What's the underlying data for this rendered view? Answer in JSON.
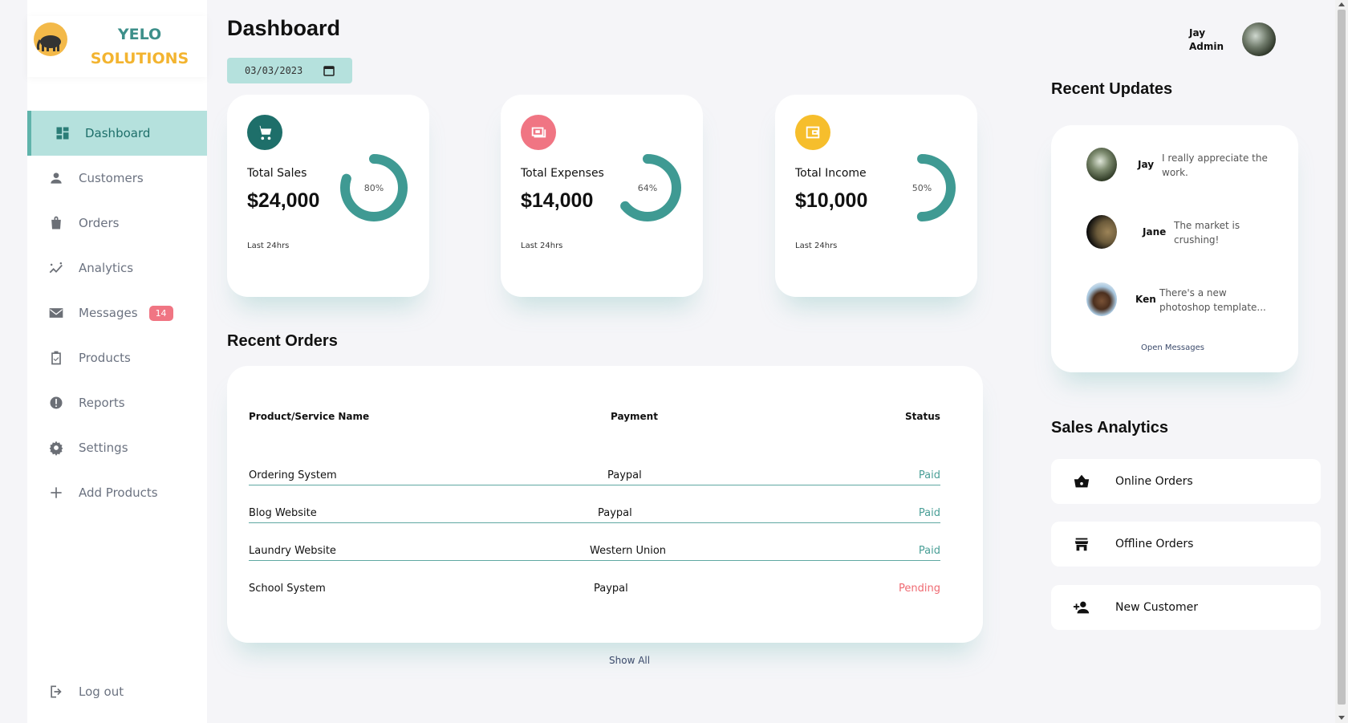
{
  "logo": {
    "line1": "YELO",
    "line2": "SOLUTIONS"
  },
  "sidebar": {
    "items": [
      {
        "label": "Dashboard",
        "icon": "dashboard-icon"
      },
      {
        "label": "Customers",
        "icon": "person-icon"
      },
      {
        "label": "Orders",
        "icon": "bag-icon"
      },
      {
        "label": "Analytics",
        "icon": "analytics-icon"
      },
      {
        "label": "Messages",
        "icon": "mail-icon",
        "badge": "14"
      },
      {
        "label": "Products",
        "icon": "clipboard-check-icon"
      },
      {
        "label": "Reports",
        "icon": "report-icon"
      },
      {
        "label": "Settings",
        "icon": "gear-icon"
      },
      {
        "label": "Add Products",
        "icon": "plus-icon"
      }
    ],
    "logout": "Log out"
  },
  "header": {
    "title": "Dashboard",
    "date": "03/03/2023"
  },
  "profile": {
    "name": "Jay",
    "role": "Admin"
  },
  "insights": [
    {
      "label": "Total Sales",
      "value": "$24,000",
      "percent": "80%",
      "sub": "Last 24hrs",
      "color": "#1e6f6a",
      "icon": "cart-icon",
      "fraction": 0.8
    },
    {
      "label": "Total Expenses",
      "value": "$14,000",
      "percent": "64%",
      "sub": "Last 24hrs",
      "color": "#f07583",
      "icon": "money-icon",
      "fraction": 0.64
    },
    {
      "label": "Total Income",
      "value": "$10,000",
      "percent": "50%",
      "sub": "Last 24hrs",
      "color": "#f6be2c",
      "icon": "wallet-icon",
      "fraction": 0.5
    }
  ],
  "orders": {
    "title": "Recent Orders",
    "headers": [
      "Product/Service Name",
      "Payment",
      "Status"
    ],
    "rows": [
      {
        "name": "Ordering System",
        "payment": "Paypal",
        "status": "Paid"
      },
      {
        "name": "Blog Website",
        "payment": "Paypal",
        "status": "Paid"
      },
      {
        "name": "Laundry Website",
        "payment": "Western Union",
        "status": "Paid"
      },
      {
        "name": "School System",
        "payment": "Paypal",
        "status": "Pending"
      }
    ],
    "show_all": "Show All"
  },
  "updates": {
    "title": "Recent Updates",
    "items": [
      {
        "name": "Jay",
        "text": "I really appreciate the work."
      },
      {
        "name": "Jane",
        "text": "The market is crushing!"
      },
      {
        "name": "Ken",
        "text": "There's a new photoshop template..."
      }
    ],
    "open_messages": "Open Messages"
  },
  "sales_analytics": {
    "title": "Sales Analytics",
    "items": [
      {
        "label": "Online Orders",
        "icon": "basket-icon"
      },
      {
        "label": "Offline Orders",
        "icon": "store-icon"
      },
      {
        "label": "New Customer",
        "icon": "add-person-icon"
      }
    ]
  },
  "colors": {
    "accent": "#5fb3ab",
    "active_bg": "#b5e1dd",
    "danger": "#f07583",
    "warning": "#f6be2c"
  }
}
